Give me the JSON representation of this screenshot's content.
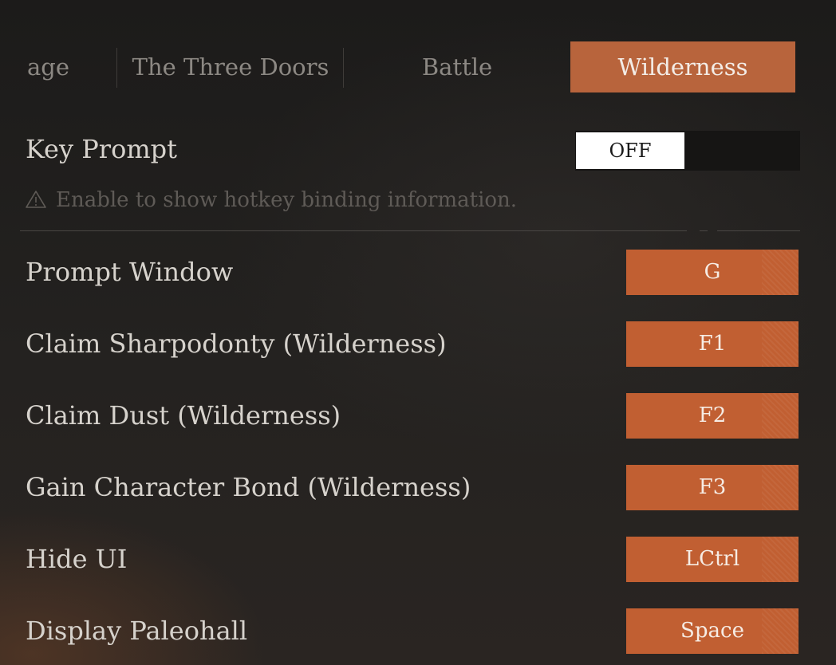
{
  "tabs": [
    {
      "label": "age"
    },
    {
      "label": "The Three Doors"
    },
    {
      "label": "Battle"
    },
    {
      "label": "Wilderness"
    }
  ],
  "key_prompt": {
    "label": "Key Prompt",
    "state": "OFF",
    "hint": "Enable to show hotkey binding information."
  },
  "bindings": [
    {
      "label": "Prompt Window",
      "key": "G"
    },
    {
      "label": "Claim Sharpodonty (Wilderness)",
      "key": "F1"
    },
    {
      "label": "Claim Dust (Wilderness)",
      "key": "F2"
    },
    {
      "label": "Gain Character Bond (Wilderness)",
      "key": "F3"
    },
    {
      "label": "Hide UI",
      "key": "LCtrl"
    },
    {
      "label": "Display Paleohall",
      "key": "Space"
    }
  ],
  "colors": {
    "accent": "#c15f32",
    "active_tab": "#b8643c",
    "background": "#1f1e1c"
  }
}
